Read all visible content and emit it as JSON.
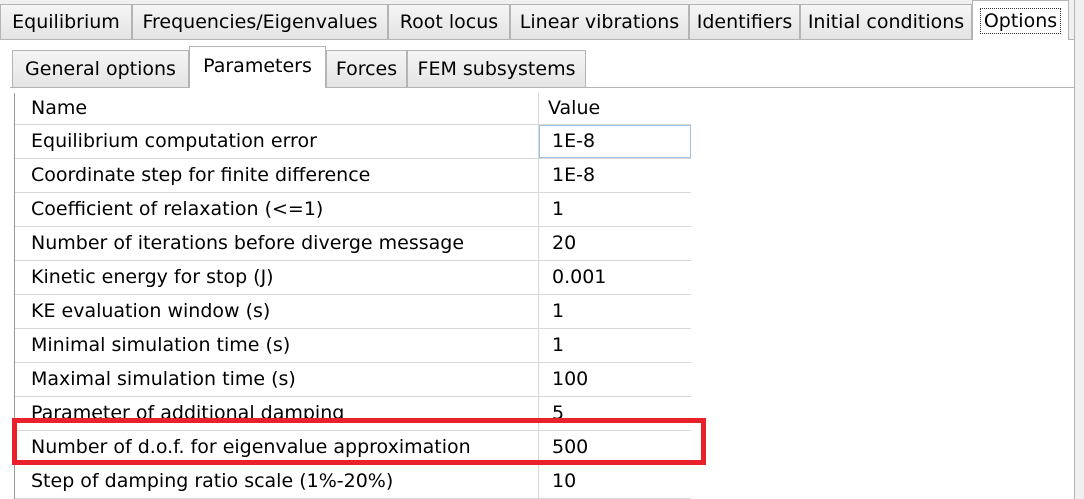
{
  "top_tabs": [
    {
      "label": "Equilibrium",
      "active": false
    },
    {
      "label": "Frequencies/Eigenvalues",
      "active": false
    },
    {
      "label": "Root locus",
      "active": false
    },
    {
      "label": "Linear vibrations",
      "active": false
    },
    {
      "label": "Identifiers",
      "active": false
    },
    {
      "label": "Initial conditions",
      "active": false
    },
    {
      "label": "Options",
      "active": true
    }
  ],
  "sub_tabs": [
    {
      "label": "General options",
      "active": false
    },
    {
      "label": "Parameters",
      "active": true
    },
    {
      "label": "Forces",
      "active": false
    },
    {
      "label": "FEM subsystems",
      "active": false
    }
  ],
  "table": {
    "headers": [
      "Name",
      "Value"
    ],
    "rows": [
      {
        "name": "Equilibrium computation error",
        "value": "1E-8"
      },
      {
        "name": "Coordinate step for finite difference",
        "value": "1E-8"
      },
      {
        "name": "Coefficient of relaxation (<=1)",
        "value": "1"
      },
      {
        "name": "Number of iterations before diverge message",
        "value": "20"
      },
      {
        "name": "Kinetic energy for stop (J)",
        "value": "0.001"
      },
      {
        "name": "KE evaluation window (s)",
        "value": "1"
      },
      {
        "name": "Minimal simulation time (s)",
        "value": "1"
      },
      {
        "name": "Maximal simulation time (s)",
        "value": "100"
      },
      {
        "name": "Parameter of additional damping",
        "value": "5"
      },
      {
        "name": "Number of d.o.f. for eigenvalue approximation",
        "value": "500"
      },
      {
        "name": "Step of damping ratio scale (1%-20%)",
        "value": "10"
      }
    ]
  },
  "colors": {
    "highlight_border": "#e8212a",
    "tab_border": "#b4b4b4",
    "editing_cell_border": "#9fc1e3"
  }
}
